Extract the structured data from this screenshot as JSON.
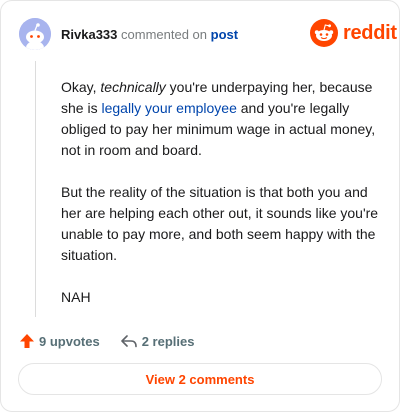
{
  "header": {
    "username": "Rivka333",
    "commented_text": "commented on",
    "post_link": "post",
    "logo_word": "reddit"
  },
  "comment": {
    "p1_start": "Okay, ",
    "p1_em": "technically",
    "p1_mid": " you're underpaying her, because she is ",
    "p1_link": "legally your employee",
    "p1_end": " and you're legally obliged to pay her minimum wage in actual money, not in room and board.",
    "p2": "But the reality of the situation is that both you and her are helping each other out, it sounds like you're unable to pay more, and both seem happy with the situation.",
    "p3": "NAH"
  },
  "actions": {
    "upvotes_label": "9 upvotes",
    "replies_label": "2 replies"
  },
  "view_button": "View 2 comments",
  "icons": {
    "avatar": "snoo-avatar-icon",
    "logo": "reddit-logo-icon",
    "upvote": "upvote-arrow-icon",
    "reply": "reply-arrow-icon"
  },
  "colors": {
    "brand": "#ff4500",
    "link": "#0045ac",
    "muted": "#787c7e",
    "avatar_bg": "#a8b4ee"
  }
}
